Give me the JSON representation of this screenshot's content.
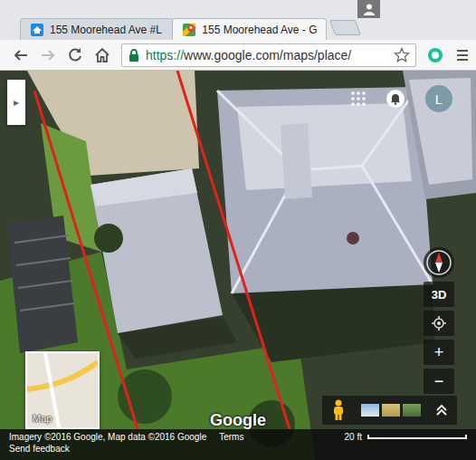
{
  "tabs": [
    {
      "label": "155 Moorehead Ave #L",
      "selected": false,
      "kind": "listing"
    },
    {
      "label": "155 Moorehead Ave - G",
      "selected": true,
      "kind": "maps"
    }
  ],
  "address_bar": {
    "scheme": "https://",
    "url": "www.google.com/maps/place/"
  },
  "map": {
    "panel_toggle": "▸",
    "avatar": "L",
    "tilt_button": "3D",
    "zoom": [
      "+",
      "−"
    ],
    "minimap_label": "Map",
    "logo": "Google"
  },
  "status_bar": {
    "attribution": "Imagery ©2016 Google, Map data ©2016 Google",
    "terms": "Terms",
    "scale": "20 ft",
    "feedback": "Send feedback"
  }
}
